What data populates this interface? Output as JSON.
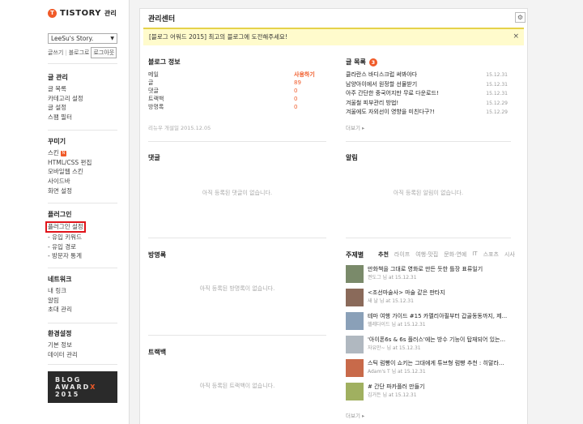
{
  "brand": {
    "name": "TISTORY",
    "suffix": "관리"
  },
  "sidebar": {
    "blog_select": "LeeSu's Story.",
    "top_links": [
      "글쓰기",
      "블로그로",
      "로그아웃"
    ],
    "groups": [
      {
        "title": "글 관리",
        "items": [
          "글 목록",
          "카테고리 설정",
          "글 설정",
          "스팸 필터"
        ]
      },
      {
        "title": "꾸미기",
        "items": [
          "스킨",
          "HTML/CSS 편집",
          "모바일웹 스킨",
          "사이드바",
          "화면 설정"
        ]
      },
      {
        "title": "플러그인",
        "items": [
          "플러그인 설정",
          "- 유입 키워드",
          "- 유입 경로",
          "- 방문자 통계"
        ]
      },
      {
        "title": "네트워크",
        "items": [
          "내 링크",
          "알림",
          "초대 관리"
        ]
      },
      {
        "title": "환경설정",
        "items": [
          "기본 정보",
          "데이터 관리"
        ]
      }
    ],
    "skin_badge": "N",
    "award": {
      "line1": "BLOG",
      "line2": "AWARD",
      "x": "X",
      "line3": "2015"
    }
  },
  "main": {
    "title": "관리센터",
    "notice": "[블로그 어워드 2015] 최고의 블로그에 도전해주세요!",
    "blog_info": {
      "title": "블로그 정보",
      "rows": [
        {
          "label": "메일",
          "value": "사용하기"
        },
        {
          "label": "글",
          "value": "89"
        },
        {
          "label": "댓글",
          "value": "0"
        },
        {
          "label": "트랙백",
          "value": "0"
        },
        {
          "label": "방명록",
          "value": "0"
        }
      ],
      "meta": "리뉴우     개설일     2015.12.05"
    },
    "posts": {
      "title": "글 목록",
      "count": "3",
      "items": [
        {
          "title": "클라란스 바디스크럽 써봐야다",
          "date": "15.12.31"
        },
        {
          "title": "남양아이에서 원정할 선물받기",
          "date": "15.12.31"
        },
        {
          "title": "아주 간단한 중국어지만 무료 다운로드!",
          "date": "15.12.31"
        },
        {
          "title": "겨울철 피부관리 방법!",
          "date": "15.12.29"
        },
        {
          "title": "겨울에도 자외선이 영향을 미친다구?!",
          "date": "15.12.29"
        }
      ],
      "more": "더보기 ▸"
    },
    "comments": {
      "title": "댓글",
      "empty": "아직 등록된 댓글이 없습니다."
    },
    "alerts": {
      "title": "알림",
      "empty": "아직 등록된 알림이 없습니다."
    },
    "guestbook": {
      "title": "방명록",
      "empty": "아직 등록된 방명록이 없습니다."
    },
    "trackback": {
      "title": "트랙백",
      "empty": "아직 등록된 트랙백이 없습니다."
    },
    "topics": {
      "title": "주제별",
      "tabs": [
        "추천",
        "라이프",
        "여행·맛집",
        "문화·연예",
        "IT",
        "스포츠",
        "시사"
      ],
      "items": [
        {
          "title": "만화책을 그대로 영화로 만든 듯한 틀장 표류일기",
          "meta": "권도그 님 at 15.12.31",
          "color": "#7a8a6a"
        },
        {
          "title": "<조선마술사> 마술 같은 판타지",
          "meta": "새 날 님 at 15.12.31",
          "color": "#8a6a5a"
        },
        {
          "title": "테마 여행 가이드 #15 카멜리아필부터 갑골동동까지, 제...",
          "meta": "헬레다이드 님 at 15.12.31",
          "color": "#8aa0b8"
        },
        {
          "title": "'아이폰6s & 6s 플러스'에는 방수 기능이 탑재되어 있는...",
          "meta": "자유만~ 님 at 15.12.31",
          "color": "#b0b8c0"
        },
        {
          "title": "스틱 럼빵이 쇼키는 그대에게 튜브형 럼빵 추천 : 히말라...",
          "meta": "Adam's T 님 at 15.12.31",
          "color": "#c86a4a"
        },
        {
          "title": "# 간단 파카플러 만들기",
          "meta": "김거든 님 at 15.12.31",
          "color": "#a0b060"
        }
      ],
      "more": "더보기 ▸"
    }
  }
}
